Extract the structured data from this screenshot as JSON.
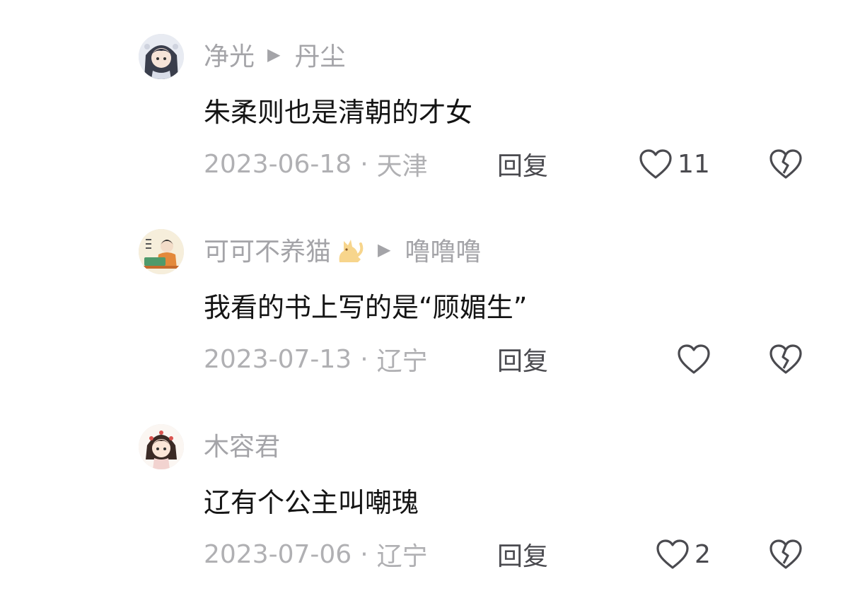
{
  "comments": [
    {
      "user": "净光",
      "reply_to": "丹尘",
      "text": "朱柔则也是清朝的才女",
      "date": "2023-06-18",
      "location": "天津",
      "reply_label": "回复",
      "likes": "11"
    },
    {
      "user": "可可不养猫",
      "reply_to": "噜噜噜",
      "text": "我看的书上写的是“顾媚生”",
      "date": "2023-07-13",
      "location": "辽宁",
      "reply_label": "回复",
      "likes": ""
    },
    {
      "user": "木容君",
      "reply_to": "",
      "text": "辽有个公主叫嘲瑰",
      "date": "2023-07-06",
      "location": "辽宁",
      "reply_label": "回复",
      "likes": "2"
    }
  ],
  "separator": "·",
  "arrow": "▶"
}
